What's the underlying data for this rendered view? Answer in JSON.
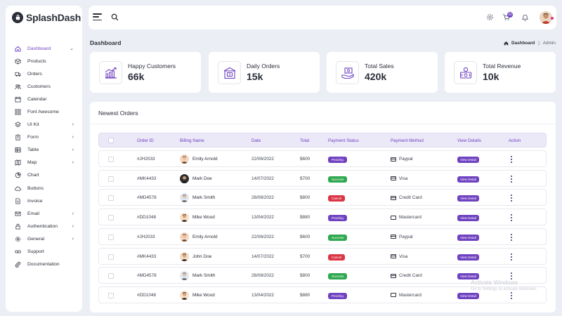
{
  "brand": {
    "name": "SplashDash"
  },
  "sidebar": {
    "items": [
      {
        "label": "Dashboard",
        "icon": "home-icon",
        "chevron": true,
        "active": true
      },
      {
        "label": "Products",
        "icon": "box-icon",
        "chevron": false
      },
      {
        "label": "Orders",
        "icon": "truck-icon",
        "chevron": false
      },
      {
        "label": "Customers",
        "icon": "users-icon",
        "chevron": false
      },
      {
        "label": "Calendar",
        "icon": "calendar-icon",
        "chevron": false
      },
      {
        "label": "Font Awesome",
        "icon": "grid-icon",
        "chevron": false
      },
      {
        "label": "UI Kit",
        "icon": "layers-icon",
        "chevron": true
      },
      {
        "label": "Form",
        "icon": "clipboard-icon",
        "chevron": true
      },
      {
        "label": "Table",
        "icon": "table-icon",
        "chevron": true
      },
      {
        "label": "Map",
        "icon": "map-icon",
        "chevron": true
      },
      {
        "label": "Chart",
        "icon": "pie-chart-icon",
        "chevron": false
      },
      {
        "label": "Buttons",
        "icon": "cloud-icon",
        "chevron": false
      },
      {
        "label": "Invoice",
        "icon": "document-icon",
        "chevron": false
      },
      {
        "label": "Email",
        "icon": "mail-icon",
        "chevron": true
      },
      {
        "label": "Authentication",
        "icon": "lock-icon",
        "chevron": true
      },
      {
        "label": "General",
        "icon": "cog-icon",
        "chevron": true
      },
      {
        "label": "Support",
        "icon": "link-icon",
        "chevron": false
      },
      {
        "label": "Documentation",
        "icon": "paperclip-icon",
        "chevron": false
      }
    ]
  },
  "topbar": {
    "cart_count": "02"
  },
  "header": {
    "title": "Dashboard",
    "breadcrumb_home": "Dashboard",
    "breadcrumb_current": "Admin"
  },
  "stats": [
    {
      "label": "Happy Customers",
      "value": "66k",
      "icon": "chart-up-icon"
    },
    {
      "label": "Daily Orders",
      "value": "15k",
      "icon": "shop-icon"
    },
    {
      "label": "Total Sales",
      "value": "420k",
      "icon": "money-hand-icon"
    },
    {
      "label": "Total Revenue",
      "value": "10k",
      "icon": "revenue-icon"
    }
  ],
  "orders": {
    "title": "Newest Orders",
    "columns": [
      "Order ID",
      "Billing Name",
      "Date",
      "Total",
      "Payment Status",
      "Payment Method",
      "View Details",
      "Action"
    ],
    "view_label": "View Detail",
    "rows": [
      {
        "id": "#JH2033",
        "name": "Emily Arnold",
        "date": "22/06/2022",
        "total": "$600",
        "status": "Pending",
        "method": "Paypal",
        "method_icon": "card-icon"
      },
      {
        "id": "#MK4433",
        "name": "Mark Doe",
        "date": "14/07/2022",
        "total": "$700",
        "status": "Success",
        "method": "Visa",
        "method_icon": "card-icon"
      },
      {
        "id": "#MD4578",
        "name": "Mark Smith",
        "date": "28/08/2022",
        "total": "$800",
        "status": "Cancel",
        "method": "Credit Card",
        "method_icon": "card-icon"
      },
      {
        "id": "#DD1048",
        "name": "Mike Wood",
        "date": "13/04/2022",
        "total": "$880",
        "status": "Pending",
        "method": "Mastercard",
        "method_icon": "monitor-icon"
      },
      {
        "id": "#JH2033",
        "name": "Emily Arnold",
        "date": "22/06/2022",
        "total": "$600",
        "status": "Success",
        "method": "Paypal",
        "method_icon": "card-icon"
      },
      {
        "id": "#MK4433",
        "name": "John Doe",
        "date": "14/07/2022",
        "total": "$700",
        "status": "Cancel",
        "method": "Visa",
        "method_icon": "card-icon"
      },
      {
        "id": "#MD4578",
        "name": "Mark Smith",
        "date": "28/08/2022",
        "total": "$800",
        "status": "Success",
        "method": "Credit Card",
        "method_icon": "card-icon"
      },
      {
        "id": "#DD1048",
        "name": "Mike Wood",
        "date": "13/04/2022",
        "total": "$880",
        "status": "Pending",
        "method": "Mastercard",
        "method_icon": "monitor-icon"
      }
    ]
  },
  "status_colors": {
    "Pending": "#6f42c1",
    "Success": "#2fa84f",
    "Cancel": "#dc3545"
  },
  "watermark": {
    "line1": "Activate Windows",
    "line2": "Go to Settings to activate Windows."
  }
}
